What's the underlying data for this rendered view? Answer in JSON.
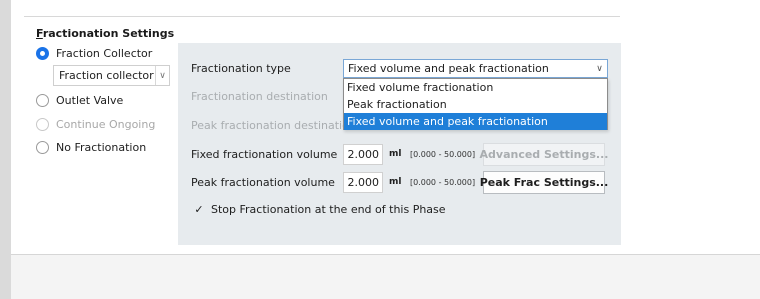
{
  "section": {
    "title_accel": "F",
    "title_rest": "ractionation Settings"
  },
  "fractionation_options": [
    {
      "label": "Fraction Collector",
      "checked": true,
      "enabled": true
    },
    {
      "label": "Outlet Valve",
      "checked": false,
      "enabled": true
    },
    {
      "label": "Continue Ongoing",
      "checked": false,
      "enabled": false
    },
    {
      "label": "No Fractionation",
      "checked": false,
      "enabled": true
    }
  ],
  "collector_select": {
    "value": "Fraction collector"
  },
  "settings": {
    "type_label": "Fractionation type",
    "type_value": "Fixed volume and peak fractionation",
    "type_options": [
      "Fixed volume fractionation",
      "Peak fractionation",
      "Fixed volume and peak fractionation"
    ],
    "destination_label": "Fractionation destination",
    "peak_destination_label": "Peak fractionation destination",
    "fixed_volume_label": "Fixed fractionation volume",
    "fixed_volume_value": "2.000",
    "fixed_volume_unit": "ml",
    "fixed_volume_range": "[0.000 - 50.000]",
    "advanced_button": "Advanced Settings...",
    "peak_volume_label": "Peak fractionation volume",
    "peak_volume_value": "2.000",
    "peak_volume_unit": "ml",
    "peak_volume_range": "[0.000 - 50.000]",
    "peak_frac_button": "Peak Frac Settings...",
    "stop_checkbox_label": "Stop Fractionation at the end of this Phase",
    "stop_checked": true
  },
  "colors": {
    "accent": "#1a73e8",
    "selection": "#1f7fd8",
    "settings_bg": "#e7ebee"
  }
}
